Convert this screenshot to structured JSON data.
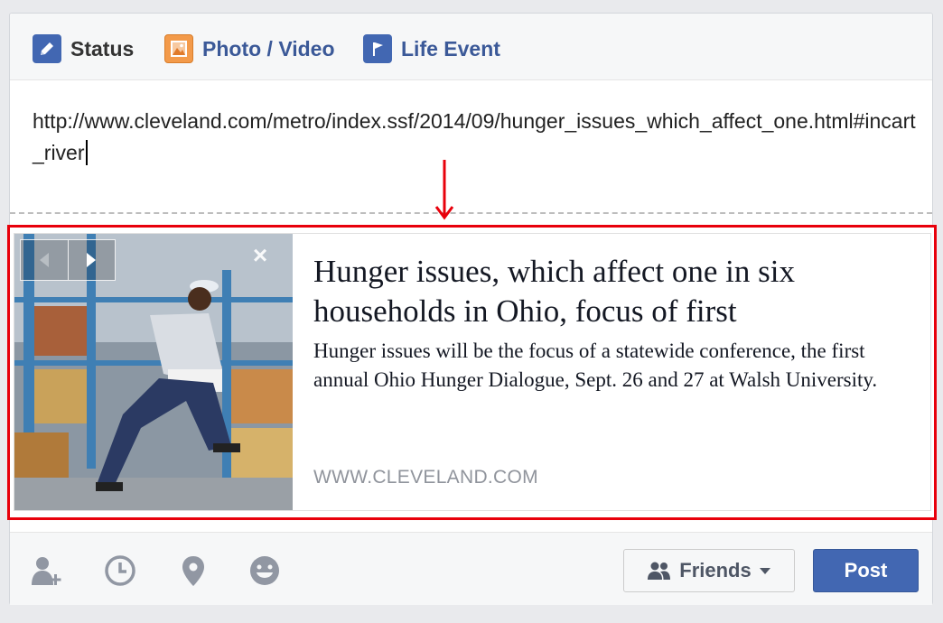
{
  "tabs": {
    "status": "Status",
    "photo_video": "Photo / Video",
    "life_event": "Life Event"
  },
  "composer": {
    "url_text": "http://www.cleveland.com/metro/index.ssf/2014/09/hunger_issues_which_affect_one.html#incart_river"
  },
  "link_preview": {
    "title": "Hunger issues, which affect one in six households in Ohio, focus of first",
    "description": "Hunger issues will be the focus of a statewide conference, the first annual Ohio Hunger Dialogue, Sept. 26 and 27 at Walsh University.",
    "domain": "WWW.CLEVELAND.COM",
    "close_glyph": "×"
  },
  "footer": {
    "audience_label": "Friends",
    "post_label": "Post",
    "icons": [
      "tag-friends-icon",
      "clock-icon",
      "location-pin-icon",
      "feeling-smiley-icon"
    ]
  },
  "colors": {
    "highlight": "#e8000b",
    "brand_blue": "#4267b2",
    "link_blue": "#3b5998"
  }
}
